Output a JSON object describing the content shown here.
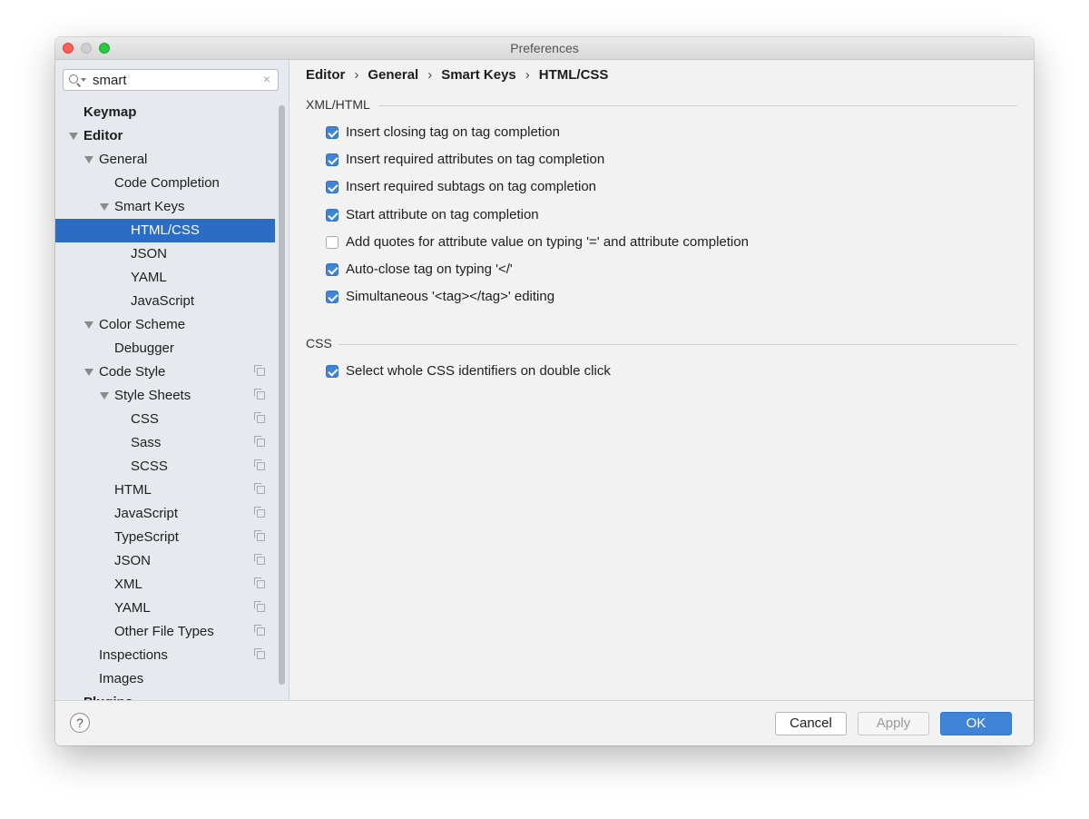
{
  "window": {
    "title": "Preferences"
  },
  "search": {
    "value": "smart",
    "clear_glyph": "×"
  },
  "tree": {
    "keymap": "Keymap",
    "editor": "Editor",
    "general": "General",
    "code_completion": "Code Completion",
    "smart_keys": "Smart Keys",
    "html_css": "HTML/CSS",
    "json": "JSON",
    "yaml": "YAML",
    "javascript": "JavaScript",
    "color_scheme": "Color Scheme",
    "debugger": "Debugger",
    "code_style": "Code Style",
    "style_sheets": "Style Sheets",
    "css": "CSS",
    "sass": "Sass",
    "scss": "SCSS",
    "cs_html": "HTML",
    "cs_javascript": "JavaScript",
    "cs_typescript": "TypeScript",
    "cs_json": "JSON",
    "cs_xml": "XML",
    "cs_yaml": "YAML",
    "other_file_types": "Other File Types",
    "inspections": "Inspections",
    "images": "Images",
    "plugins": "Plugins"
  },
  "breadcrumb": {
    "items": [
      "Editor",
      "General",
      "Smart Keys",
      "HTML/CSS"
    ],
    "separator": "›"
  },
  "sections": {
    "xml_html": {
      "title": "XML/HTML",
      "options": [
        {
          "label": "Insert closing tag on tag completion",
          "checked": true
        },
        {
          "label": "Insert required attributes on tag completion",
          "checked": true
        },
        {
          "label": "Insert required subtags on tag completion",
          "checked": true
        },
        {
          "label": "Start attribute on tag completion",
          "checked": true
        },
        {
          "label": "Add quotes for attribute value on typing '=' and attribute completion",
          "checked": false
        },
        {
          "label": "Auto-close tag on typing '</'",
          "checked": true
        },
        {
          "label": "Simultaneous '<tag></tag>' editing",
          "checked": true
        }
      ]
    },
    "css": {
      "title": "CSS",
      "options": [
        {
          "label": "Select whole CSS identifiers on double click",
          "checked": true
        }
      ]
    }
  },
  "footer": {
    "help": "?",
    "cancel": "Cancel",
    "apply": "Apply",
    "ok": "OK"
  },
  "colors": {
    "accent": "#3f84d6",
    "selection": "#2b6cc4",
    "sidebar_bg": "#e6e9ed",
    "content_bg": "#f2f2f2"
  }
}
